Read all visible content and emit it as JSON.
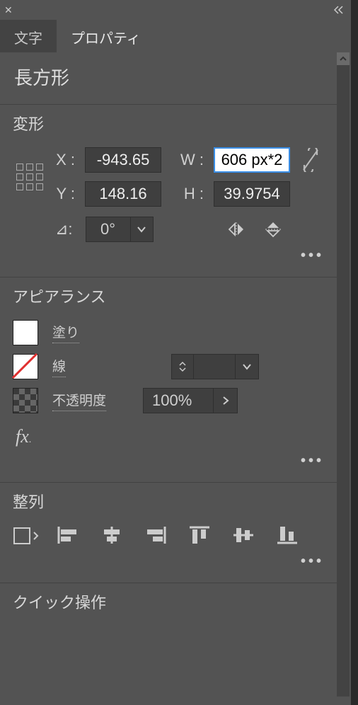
{
  "tabs": {
    "text": "文字",
    "props": "プロパティ"
  },
  "shape_title": "長方形",
  "sections": {
    "transform": "変形",
    "appearance": "アピアランス",
    "align": "整列",
    "quick": "クイック操作"
  },
  "transform": {
    "x_label": "X :",
    "y_label": "Y :",
    "w_label": "W :",
    "h_label": "H :",
    "x": "-943.65",
    "y": "148.16",
    "w": "606 px*2",
    "h": "39.9754",
    "angle_label": "⊿:",
    "angle": "0°"
  },
  "appearance": {
    "fill_label": "塗り",
    "stroke_label": "線",
    "opacity_label": "不透明度",
    "opacity_value": "100%"
  },
  "fx_label": "fx",
  "more": "•••"
}
